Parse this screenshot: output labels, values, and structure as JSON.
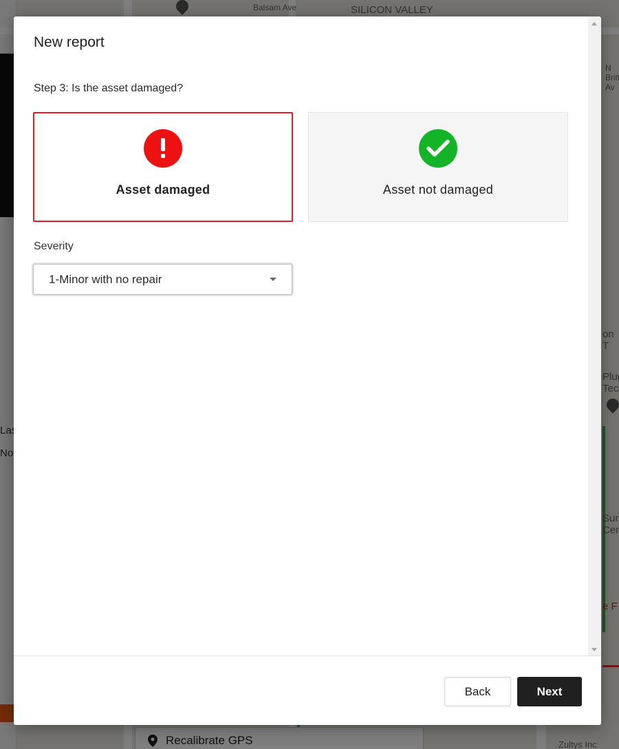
{
  "modal": {
    "title": "New report",
    "step_label": "Step 3: Is the asset damaged?",
    "options": [
      {
        "label": "Asset damaged",
        "icon": "exclamation-icon",
        "selected": true,
        "color": "#ee1111"
      },
      {
        "label": "Asset not damaged",
        "icon": "checkmark-icon",
        "selected": false,
        "color": "#13b427"
      }
    ],
    "severity": {
      "label": "Severity",
      "value": "1-Minor with no repair"
    },
    "footer": {
      "back_label": "Back",
      "next_label": "Next"
    }
  },
  "background": {
    "map_labels": [
      "Balsam Ave",
      "SILICON VALLEY",
      "N Britton Av",
      "on T",
      "Plug Tech",
      "Sun Cent",
      "e F",
      "Zultys Inc"
    ],
    "toolbar_label": "Recalibrate GPS",
    "side_text": [
      "Las",
      "Nov"
    ]
  }
}
